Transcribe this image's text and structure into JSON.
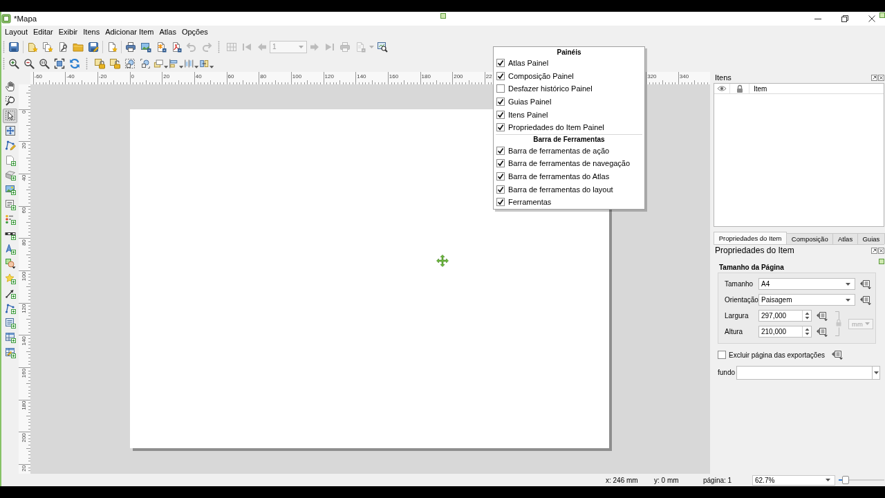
{
  "window": {
    "title": "*Mapa"
  },
  "menu_bar": [
    "Layout",
    "Editar",
    "Exibir",
    "Itens",
    "Adicionar Item",
    "Atlas",
    "Opções"
  ],
  "layout_toolbar": {
    "buttons": [
      {
        "disabled": false
      },
      {
        "disabled": false
      },
      {
        "disabled": false
      },
      {
        "disabled": false
      },
      {
        "disabled": false
      },
      {
        "disabled": false
      },
      {
        "disabled": false
      },
      {
        "disabled": false
      },
      {
        "disabled": false
      },
      {
        "disabled": false
      },
      {
        "disabled": false
      },
      {
        "disabled": true
      },
      {
        "disabled": true
      }
    ]
  },
  "atlas_toolbar": {
    "buttons_before": [
      {
        "disabled": true
      },
      {
        "disabled": true
      },
      {
        "disabled": true
      }
    ],
    "page_field": {
      "value": "1",
      "disabled": true
    },
    "buttons_after": [
      {
        "disabled": true
      },
      {
        "disabled": true
      },
      {
        "disabled": true
      },
      {
        "disabled": true
      },
      {
        "disabled": false
      }
    ]
  },
  "tools_toolbar": {
    "buttons": [
      {
        "selected": false
      },
      {
        "selected": false
      },
      {
        "selected": true
      },
      {
        "selected": false
      },
      {
        "selected": false
      },
      {
        "selected": false
      },
      {
        "selected": false
      },
      {
        "selected": false
      },
      {
        "selected": false
      },
      {
        "selected": false
      },
      {
        "selected": false
      },
      {
        "selected": false
      },
      {
        "selected": false
      },
      {
        "selected": false
      },
      {
        "selected": false
      },
      {
        "selected": false
      },
      {
        "selected": false
      },
      {
        "selected": false
      },
      {
        "selected": false
      }
    ]
  },
  "top_ruler": {
    "labels": [
      "-60",
      "-40",
      "-20",
      "0",
      "20",
      "40",
      "60",
      "80",
      "100",
      "120",
      "140",
      "160",
      "180",
      "200",
      "22"
    ],
    "labels_after_menu": [
      "320",
      "340"
    ]
  },
  "left_ruler": {
    "labels": [
      "0",
      "20",
      "40",
      "60",
      "80",
      "100",
      "120",
      "140",
      "160",
      "180",
      "200",
      "20"
    ]
  },
  "view_menu": {
    "sections": [
      {
        "heading": "Painéis",
        "items": [
          {
            "label": "Atlas Painel",
            "checked": true
          },
          {
            "label": "Composição Painel",
            "checked": true
          },
          {
            "label": "Desfazer histórico Painel",
            "checked": false
          },
          {
            "label": "Guias Painel",
            "checked": true
          },
          {
            "label": "Itens Painel",
            "checked": true
          },
          {
            "label": "Propriedades do Item Painel",
            "checked": true
          }
        ]
      },
      {
        "heading": "Barra de Ferramentas",
        "items": [
          {
            "label": "Barra de ferramentas de ação",
            "checked": true
          },
          {
            "label": "Barra de ferramentas de navegação",
            "checked": true
          },
          {
            "label": "Barra de ferramentas do Atlas",
            "checked": true
          },
          {
            "label": "Barra de ferramentas do layout",
            "checked": true
          },
          {
            "label": "Ferramentas",
            "checked": true
          }
        ]
      }
    ]
  },
  "items_panel": {
    "title": "Itens",
    "column_3": "Item"
  },
  "dock_tabs": [
    {
      "label": "Propriedades do Item",
      "selected": true
    },
    {
      "label": "Composição",
      "selected": false
    },
    {
      "label": "Atlas",
      "selected": false
    },
    {
      "label": "Guias",
      "selected": false
    }
  ],
  "item_properties": {
    "title": "Propriedades do Item",
    "group_title": "Tamanho da Página",
    "fields": [
      {
        "kind": "dropdown",
        "label": "Tamanho",
        "value": "A4"
      },
      {
        "kind": "dropdown",
        "label": "Orientação",
        "value": "Paisagem"
      },
      {
        "kind": "spinbox",
        "label": "Largura",
        "value": "297,000"
      },
      {
        "kind": "spinbox",
        "label": "Altura",
        "value": "210,000"
      }
    ],
    "units": {
      "value": "mm",
      "disabled": true
    },
    "exclude_page": {
      "label": "Excluir página das exportações",
      "checked": false
    },
    "background": {
      "label": "fundo"
    }
  },
  "status_bar": {
    "x": "x: 246 mm",
    "y": "y: 0 mm",
    "page": "página: 1",
    "zoom": "62.7%",
    "zoom_slider": {
      "level": 0.08
    }
  }
}
